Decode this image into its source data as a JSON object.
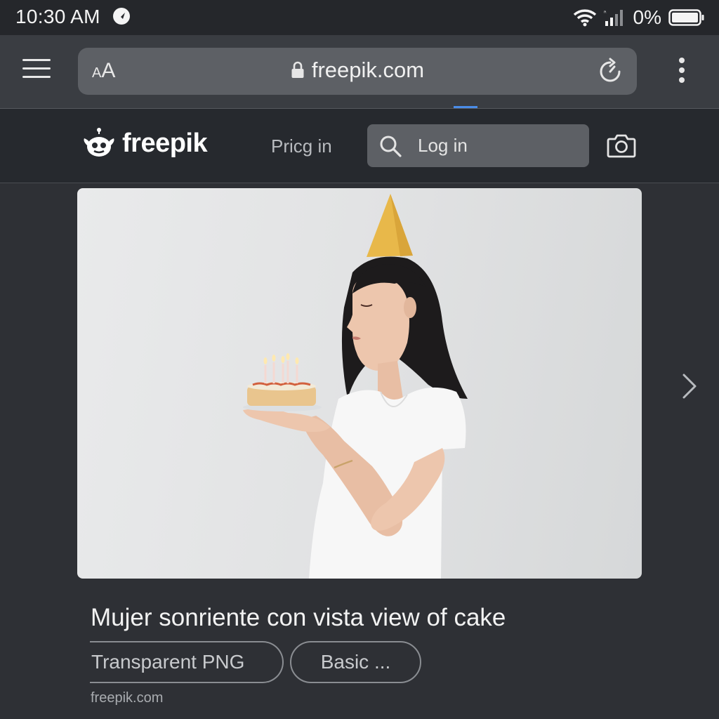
{
  "status_bar": {
    "time": "10:30 AM",
    "battery_percent": "0%",
    "icons": [
      "navigation-icon",
      "wifi-icon",
      "signal-icon",
      "battery-icon"
    ]
  },
  "browser": {
    "text_size_button_small": "A",
    "text_size_button_large": "A",
    "url": "freepik.com",
    "icons": [
      "menu-icon",
      "lock-icon",
      "reload-icon",
      "more-options-icon"
    ]
  },
  "site": {
    "logo_text": "freepik",
    "pricing_link": "Pricg in",
    "search_placeholder": "Log in",
    "icons": [
      "freepik-logo-icon",
      "search-icon",
      "camera-icon"
    ]
  },
  "result": {
    "title": "Mujer sonriente con vista view of cake",
    "tags": [
      "Transparent PNG",
      "Basic ..."
    ],
    "source": "freepik.com",
    "icons": [
      "chevron-right-icon"
    ]
  },
  "colors": {
    "background": "#2e3035",
    "status_bar": "#25272b",
    "browser_chrome": "#3a3d42",
    "url_bar": "#5d6065",
    "site_header": "#26292e",
    "accent_loading": "#4a8ce8"
  }
}
